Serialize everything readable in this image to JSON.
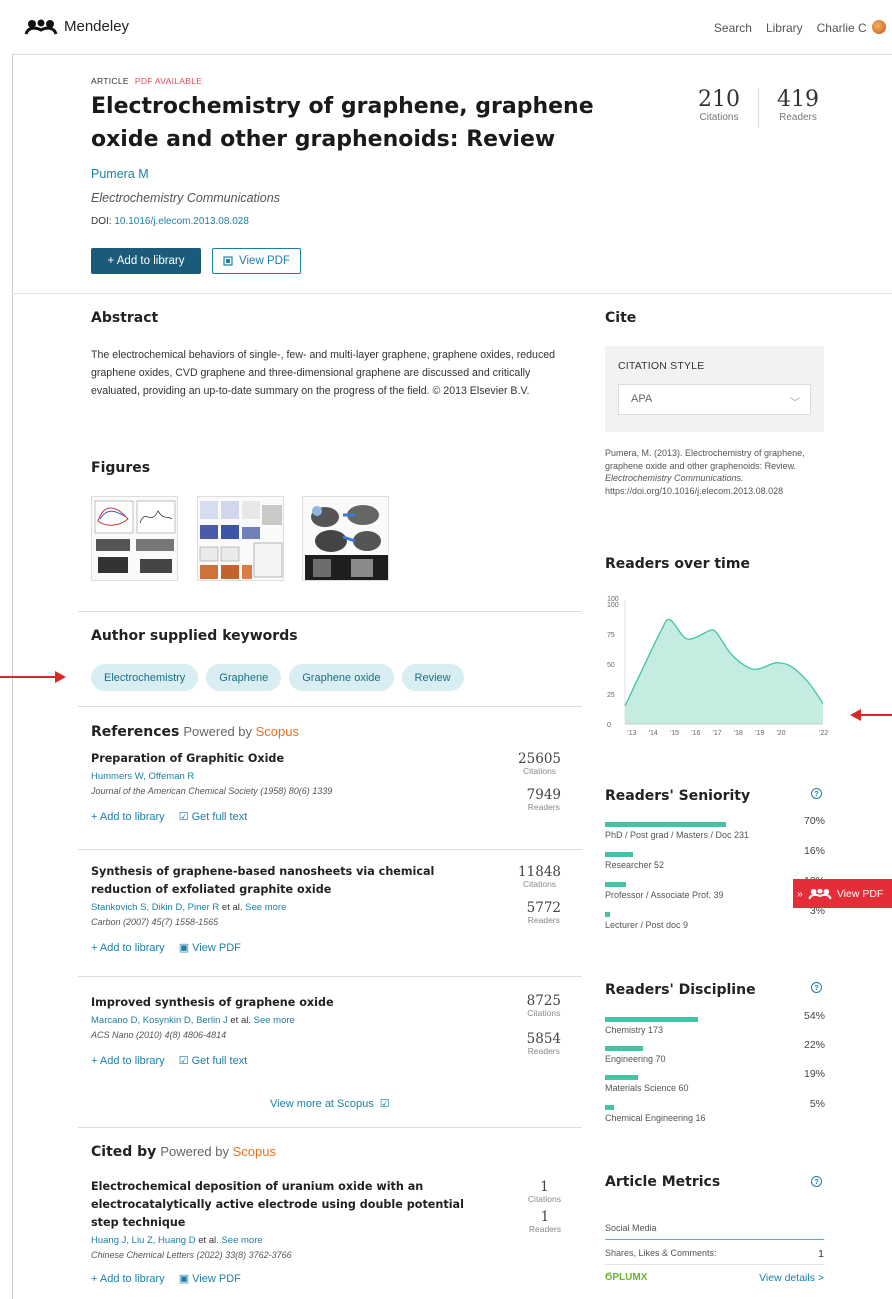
{
  "header": {
    "brand": "Mendeley",
    "nav": {
      "search": "Search",
      "library": "Library",
      "user": "Charlie C"
    }
  },
  "article": {
    "type_label": "ARTICLE",
    "pdf_label": "PDF AVAILABLE",
    "title": "Electrochemistry of graphene, graphene oxide and other graphenoids: Review",
    "author": "Pumera M",
    "journal": "Electrochemistry Communications",
    "doi_label": "DOI:",
    "doi": "10.1016/j.elecom.2013.08.028",
    "citations": "210",
    "citations_label": "Citations",
    "readers": "419",
    "readers_label": "Readers",
    "add_button": "+ Add to library",
    "view_pdf_button": "View PDF"
  },
  "abstract": {
    "heading": "Abstract",
    "text": "The electrochemical behaviors of single-, few- and multi-layer graphene, graphene oxides, reduced graphene oxides, CVD graphene and three-dimensional graphene are discussed and critically evaluated, providing an up-to-date summary on the progress of the field. © 2013 Elsevier B.V."
  },
  "figures": {
    "heading": "Figures"
  },
  "keywords": {
    "heading": "Author supplied keywords",
    "items": [
      "Electrochemistry",
      "Graphene",
      "Graphene oxide",
      "Review"
    ]
  },
  "references": {
    "heading": "References",
    "powered_prefix": "Powered by",
    "powered_brand": "Scopus",
    "view_more": "View more at Scopus",
    "items": [
      {
        "title": "Preparation of Graphitic Oxide",
        "authors": "Hummers W, Offeman R",
        "authors_extra": "",
        "see_more": "",
        "journal": "Journal of the American Chemical Society (1958) 80(6) 1339",
        "citations": "25605",
        "readers": "7949",
        "action1": "+ Add to library",
        "action2": "Get full text"
      },
      {
        "title": "Synthesis of graphene-based nanosheets via chemical reduction of exfoliated graphite oxide",
        "authors": "Stankovich S, Dikin D, Piner R",
        "authors_extra": " et al.",
        "see_more": " See more",
        "journal": "Carbon (2007) 45(7) 1558-1565",
        "citations": "11848",
        "readers": "5772",
        "action1": "+ Add to library",
        "action2": "View PDF"
      },
      {
        "title": "Improved synthesis of graphene oxide",
        "authors": "Marcano D, Kosynkin D, Berlin J",
        "authors_extra": " et al.",
        "see_more": " See more",
        "journal": "ACS Nano (2010) 4(8) 4806-4814",
        "citations": "8725",
        "readers": "5854",
        "action1": "+ Add to library",
        "action2": "Get full text"
      }
    ],
    "citations_label": "Citations",
    "readers_label": "Readers"
  },
  "cited_by": {
    "heading": "Cited by",
    "powered_prefix": "Powered by",
    "powered_brand": "Scopus",
    "items": [
      {
        "title": "Electrochemical deposition of uranium oxide with an electrocatalytically active electrode using double potential step technique",
        "authors": "Huang J, Liu Z, Huang D",
        "authors_extra": " et al.",
        "see_more": " See more",
        "journal": "Chinese Chemical Letters (2022) 33(8) 3762-3766",
        "citations": "1",
        "readers": "1",
        "action1": "+ Add to library",
        "action2": "View PDF"
      }
    ]
  },
  "cite": {
    "heading": "Cite",
    "style_label": "CITATION STYLE",
    "style_value": "APA",
    "text_plain": "Pumera, M. (2013). Electrochemistry of graphene, graphene oxide and other graphenoids: Review.",
    "text_italic": "Electrochemistry Communications.",
    "text_doi": "https://doi.org/10.1016/j.elecom.2013.08.028"
  },
  "readers_over_time": {
    "heading": "Readers over time"
  },
  "chart_data": {
    "type": "area",
    "title": "Readers over time",
    "x": [
      "'13",
      "'14",
      "'15",
      "'16",
      "'17",
      "'18",
      "'19",
      "'20",
      "'22"
    ],
    "x_numeric": [
      2013,
      2014,
      2015,
      2016,
      2017,
      2018,
      2019,
      2020,
      2022
    ],
    "y_ticks": [
      "0",
      "25",
      "50",
      "75",
      "100",
      "100"
    ],
    "ylim": [
      0,
      100
    ],
    "points": [
      [
        2012.7,
        15
      ],
      [
        2013.5,
        45
      ],
      [
        2014.4,
        78
      ],
      [
        2014.8,
        87
      ],
      [
        2015.5,
        72
      ],
      [
        2016.0,
        72
      ],
      [
        2016.7,
        78
      ],
      [
        2017.0,
        76
      ],
      [
        2017.7,
        58
      ],
      [
        2018.5,
        47
      ],
      [
        2019.0,
        46
      ],
      [
        2019.8,
        51
      ],
      [
        2020.5,
        48
      ],
      [
        2021.3,
        35
      ],
      [
        2022.0,
        17
      ]
    ],
    "color": "#3fc4a7",
    "fill": "#c4ece1"
  },
  "seniority": {
    "heading": "Readers' Seniority",
    "help": "?",
    "items": [
      {
        "label": "PhD / Post grad / Masters / Doc 231",
        "pct": "70%",
        "fraction": 0.7
      },
      {
        "label": "Researcher 52",
        "pct": "16%",
        "fraction": 0.16
      },
      {
        "label": "Professor / Associate Prof. 39",
        "pct": "12%",
        "fraction": 0.12
      },
      {
        "label": "Lecturer / Post doc 9",
        "pct": "3%",
        "fraction": 0.03
      }
    ]
  },
  "discipline": {
    "heading": "Readers' Discipline",
    "help": "?",
    "items": [
      {
        "label": "Chemistry 173",
        "pct": "54%",
        "fraction": 0.54
      },
      {
        "label": "Engineering 70",
        "pct": "22%",
        "fraction": 0.22
      },
      {
        "label": "Materials Science 60",
        "pct": "19%",
        "fraction": 0.19
      },
      {
        "label": "Chemical Engineering 16",
        "pct": "5%",
        "fraction": 0.05
      }
    ]
  },
  "metrics": {
    "heading": "Article Metrics",
    "help": "?",
    "social_label": "Social Media",
    "shares_label": "Shares, Likes & Comments:",
    "shares_value": "1",
    "plumx": "PLUMX",
    "view_details": "View details >"
  },
  "floating": {
    "label": "View PDF"
  },
  "colors": {
    "accent": "#1c7fa5",
    "primary_btn": "#1a5b7a",
    "teal": "#3fc4a7",
    "scopus": "#e9711c",
    "red": "#e42d36"
  }
}
